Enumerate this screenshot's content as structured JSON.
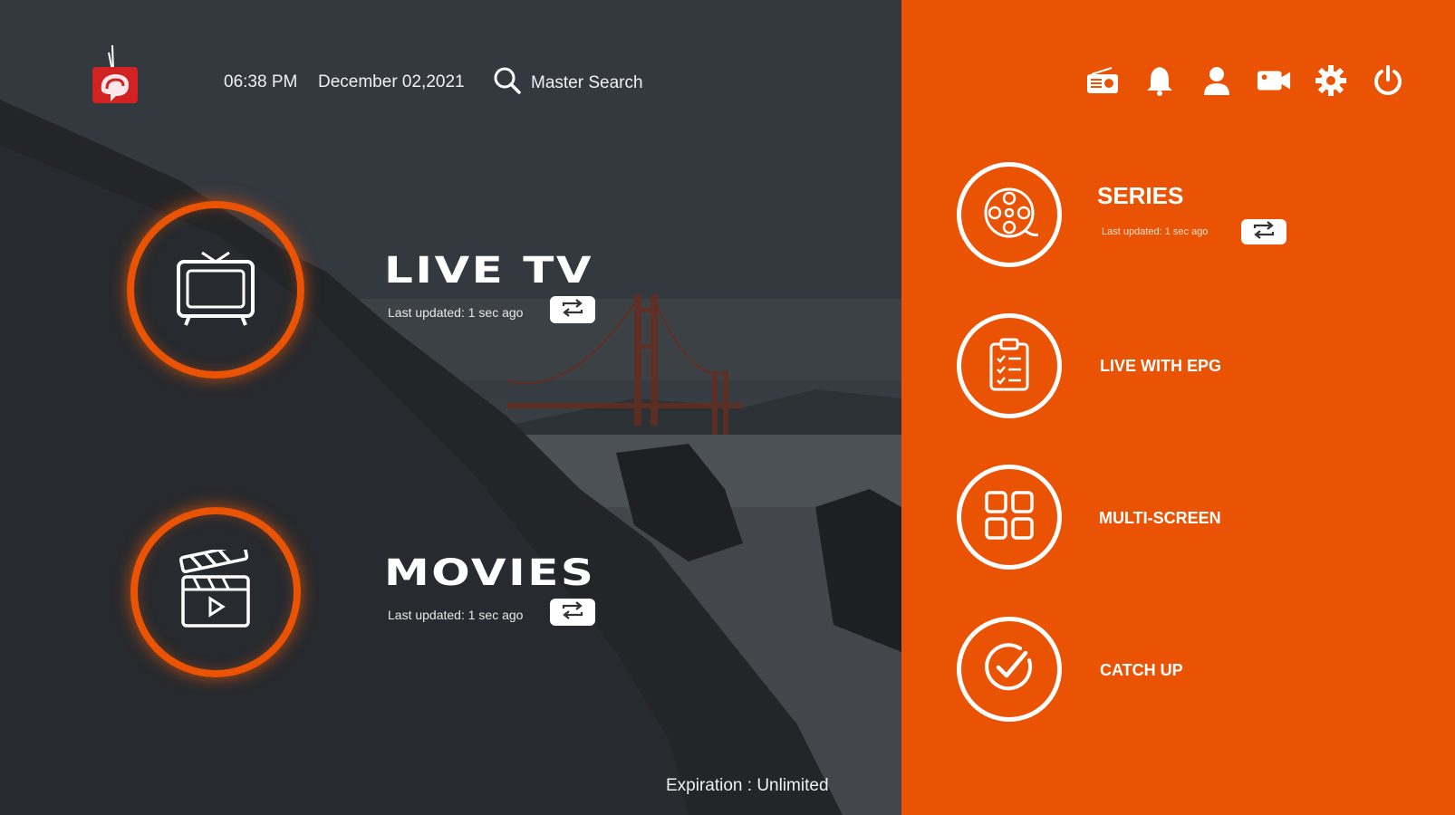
{
  "header": {
    "time": "06:38 PM",
    "date": "December 02,2021",
    "search_label": "Master Search"
  },
  "top_icons": [
    "radio-icon",
    "bell-icon",
    "user-icon",
    "video-camera-icon",
    "gear-icon",
    "power-icon"
  ],
  "main_tiles": [
    {
      "title": "LIVE TV",
      "updated": "Last updated: 1 sec ago",
      "icon": "tv-icon"
    },
    {
      "title": "MOVIES",
      "updated": "Last updated: 1 sec ago",
      "icon": "clapperboard-icon"
    }
  ],
  "side_menu": [
    {
      "label": "SERIES",
      "updated": "Last updated: 1 sec ago",
      "icon": "film-reel-icon"
    },
    {
      "label": "LIVE WITH EPG",
      "icon": "clipboard-checklist-icon"
    },
    {
      "label": "MULTI-SCREEN",
      "icon": "grid-icon"
    },
    {
      "label": "CATCH UP",
      "icon": "check-circle-icon"
    }
  ],
  "footer": {
    "expiration": "Expiration : Unlimited"
  },
  "colors": {
    "accent": "#ea5304",
    "dark": "#2a2c30"
  }
}
